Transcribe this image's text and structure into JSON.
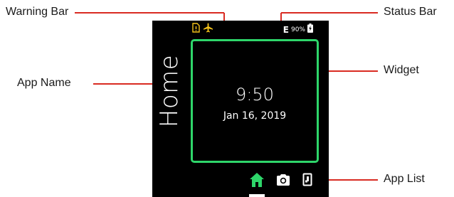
{
  "colors": {
    "leader": "#d92b22",
    "accent": "#2ed66a",
    "warning": "#f4c21a",
    "screen_bg": "#000000"
  },
  "callouts": {
    "warning_bar": "Warning Bar",
    "status_bar": "Status Bar",
    "app_name": "App Name",
    "widget": "Widget",
    "app_list": "App List"
  },
  "screen": {
    "app_name": "Home",
    "status_bar": {
      "network": "E",
      "battery": "90%",
      "icons": [
        "network-e-icon",
        "battery-icon"
      ]
    },
    "warning_bar": {
      "icons": [
        "sim-warning-icon",
        "airplane-icon"
      ]
    },
    "widget": {
      "time": "9:50",
      "date": "Jan 16, 2019"
    },
    "app_list": {
      "items": [
        "home-icon",
        "camera-icon",
        "device-icon"
      ],
      "selected": "home-icon"
    }
  }
}
